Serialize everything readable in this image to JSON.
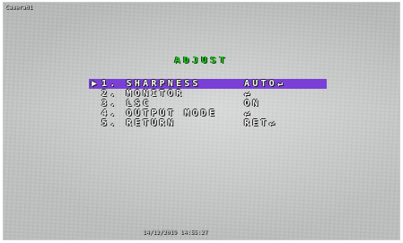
{
  "camera_label": "Camera01",
  "osd_menu": {
    "title": "ADJUST",
    "cursor": "▶",
    "items": [
      {
        "label": "1. SHARPNESS",
        "value": "AUTO↵",
        "selected": true
      },
      {
        "label": "2. MONITOR",
        "value": "↵",
        "selected": false
      },
      {
        "label": "3. LSC",
        "value": "ON",
        "selected": false
      },
      {
        "label": "4. OUTPUT MODE",
        "value": "↵",
        "selected": false
      },
      {
        "label": "5. RETURN",
        "value": "RET↵",
        "selected": false
      }
    ]
  },
  "timestamp": "14/12/2019 14:55:27",
  "colors": {
    "title": "#1fd01f",
    "highlight": "#7a3fd6",
    "menu_text": "#f6f6f6"
  }
}
